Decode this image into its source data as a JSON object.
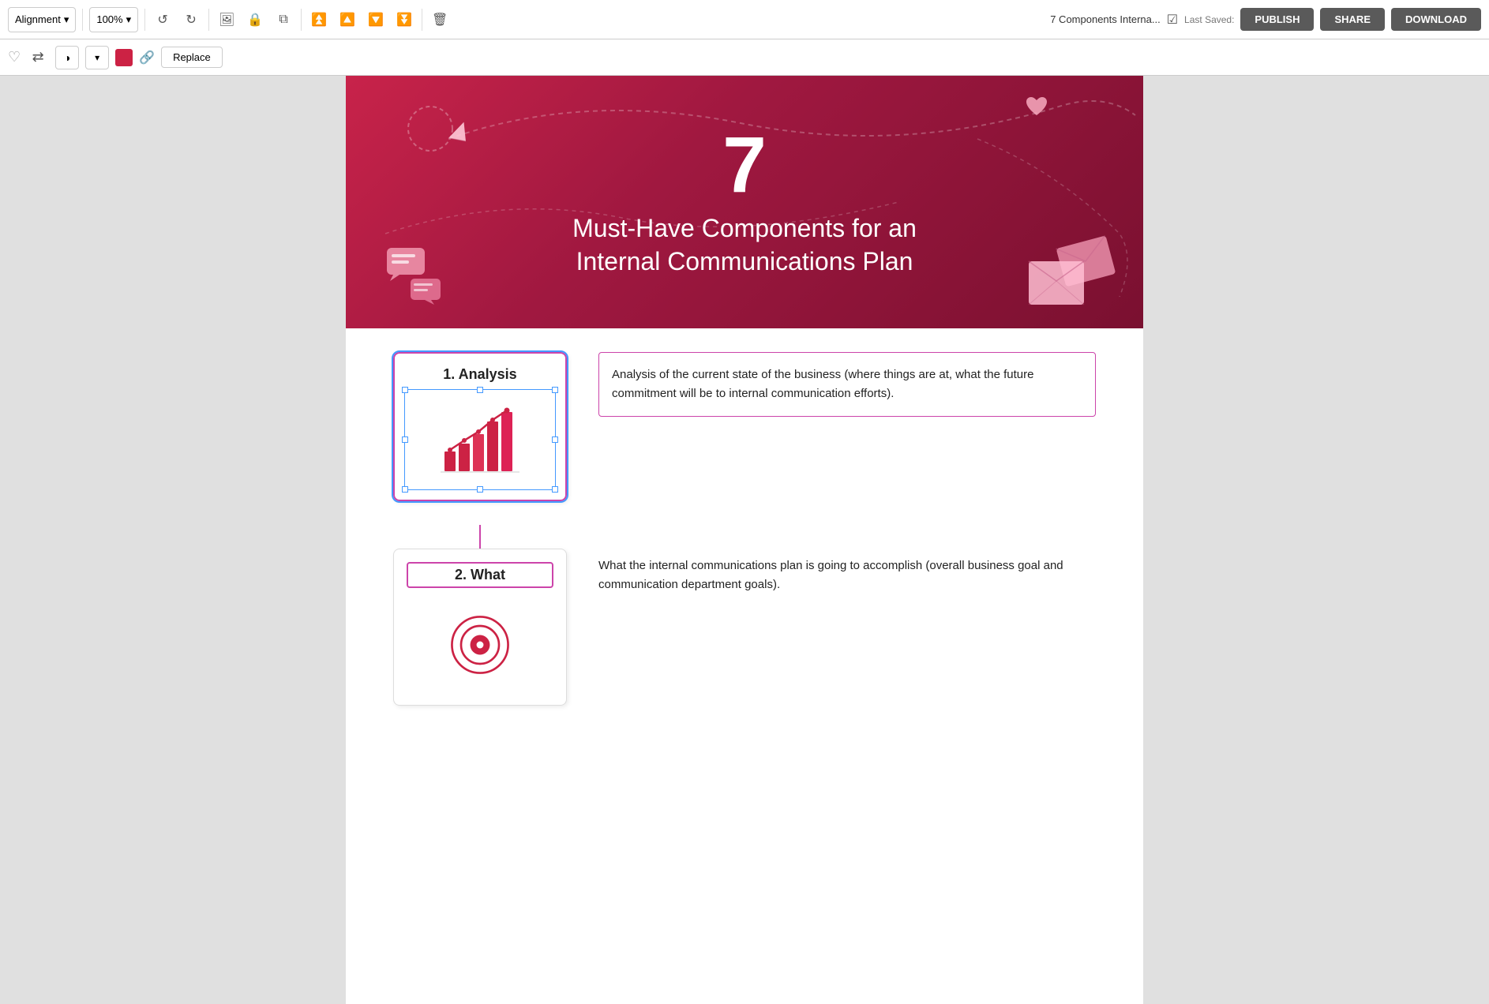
{
  "toolbar": {
    "alignment_label": "Alignment",
    "zoom_label": "100%",
    "doc_title": "7 Components Interna...",
    "last_saved_label": "Last Saved:",
    "publish_label": "PUBLISH",
    "share_label": "SHARE",
    "download_label": "DOWNLOAD"
  },
  "toolbar2": {
    "replace_label": "Replace"
  },
  "hero": {
    "number": "7",
    "subtitle_line1": "Must-Have Components for an",
    "subtitle_line2": "Internal Communications Plan"
  },
  "card1": {
    "title": "1. Analysis",
    "description": "Analysis of the current state of the business (where things are at, what the future commitment will be to internal communication efforts)."
  },
  "card2": {
    "title": "2. What",
    "description": "What the internal communications plan is going to accomplish (overall business goal and communication department goals)."
  }
}
